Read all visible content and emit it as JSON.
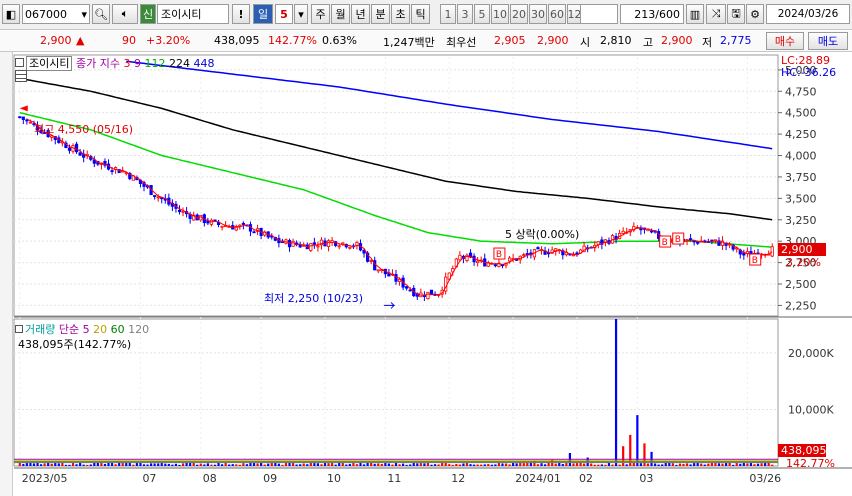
{
  "toolbar": {
    "code": "067000",
    "new_badge": "신",
    "stock_name": "조이시티",
    "alert_btn": "!",
    "period_unit": "일",
    "period_num": "5",
    "periods": [
      "주",
      "월",
      "년",
      "분",
      "초",
      "틱"
    ],
    "intervals": [
      "1",
      "3",
      "5",
      "10",
      "20",
      "30",
      "60",
      "120"
    ],
    "count": "213",
    "count_total": "/600",
    "date": "2024/03/26"
  },
  "price_bar": {
    "price": "2,900",
    "arrow": "▲",
    "change": "90",
    "change_pct": "+3.20%",
    "volume": "438,095",
    "vol_ratio": "142.77%",
    "turnover": "0.63%",
    "amount": "1,247백만",
    "best_ask_label": "최우선",
    "best_ask": "2,905",
    "best_bid": "2,900",
    "open_label": "시",
    "open": "2,810",
    "high_label": "고",
    "high": "2,900",
    "low_label": "저",
    "low": "2,775",
    "buy_btn": "매수",
    "sell_btn": "매도"
  },
  "colors": {
    "up": "#ff0000",
    "down": "#0000ff",
    "ma3": "#ff0000",
    "ma9": "#a000a0",
    "ma112": "#00dd00",
    "ma224": "#000000",
    "ma448": "#0000ff"
  },
  "chart_data": [
    {
      "type": "candlestick",
      "legend": {
        "title": "조이시티",
        "label": "종가 지수",
        "periods": [
          "3",
          "9",
          "112",
          "224",
          "448"
        ]
      },
      "ylim": [
        2150,
        5150
      ],
      "yticks": [
        5000,
        4750,
        4500,
        4250,
        4000,
        3750,
        3500,
        3250,
        3000,
        2750,
        2500,
        2250
      ],
      "ytick_labels": [
        "5,000",
        "4,750",
        "4,500",
        "4,250",
        "4,000",
        "3,750",
        "3,500",
        "3,250",
        "3,000",
        "2,750",
        "2,500",
        "2,250"
      ],
      "corner_labels": {
        "lc": "LC:28.89",
        "hc": "HC:-36.26"
      },
      "current_price": "2,900",
      "current_change": "3.20%",
      "high_annotation": "최고 4,550 (05/16)",
      "low_annotation": "최저 2,250 (10/23)",
      "signal_annotation": "5 상락(0.00%)",
      "signal_labels": [
        "B",
        "B",
        "B",
        "B"
      ],
      "x_labels": [
        "2023/05",
        "07",
        "08",
        "09",
        "10",
        "11",
        "12",
        "2024/01",
        "02",
        "03",
        "03/26"
      ],
      "close_anchors": [
        [
          0,
          4450
        ],
        [
          10,
          4200
        ],
        [
          20,
          3950
        ],
        [
          30,
          3800
        ],
        [
          38,
          3550
        ],
        [
          45,
          3350
        ],
        [
          55,
          3200
        ],
        [
          65,
          3150
        ],
        [
          72,
          3000
        ],
        [
          80,
          2950
        ],
        [
          88,
          3000
        ],
        [
          95,
          2950
        ],
        [
          100,
          2700
        ],
        [
          106,
          2550
        ],
        [
          112,
          2380
        ],
        [
          118,
          2400
        ],
        [
          124,
          2820
        ],
        [
          130,
          2750
        ],
        [
          137,
          2760
        ],
        [
          144,
          2850
        ],
        [
          150,
          2900
        ],
        [
          156,
          2850
        ],
        [
          162,
          2950
        ],
        [
          168,
          3050
        ],
        [
          174,
          3150
        ],
        [
          180,
          3050
        ],
        [
          186,
          3000
        ],
        [
          192,
          3000
        ],
        [
          198,
          2980
        ],
        [
          204,
          2840
        ],
        [
          212,
          2900
        ]
      ],
      "ma224": [
        [
          0,
          4900
        ],
        [
          20,
          4750
        ],
        [
          40,
          4550
        ],
        [
          60,
          4300
        ],
        [
          80,
          4100
        ],
        [
          100,
          3900
        ],
        [
          120,
          3700
        ],
        [
          140,
          3580
        ],
        [
          160,
          3500
        ],
        [
          180,
          3400
        ],
        [
          200,
          3320
        ],
        [
          212,
          3250
        ]
      ],
      "ma448": [
        [
          30,
          5100
        ],
        [
          60,
          4950
        ],
        [
          90,
          4800
        ],
        [
          120,
          4600
        ],
        [
          150,
          4420
        ],
        [
          180,
          4280
        ],
        [
          212,
          4080
        ]
      ],
      "ma112": [
        [
          0,
          4500
        ],
        [
          20,
          4300
        ],
        [
          40,
          4000
        ],
        [
          60,
          3800
        ],
        [
          80,
          3600
        ],
        [
          100,
          3300
        ],
        [
          115,
          3100
        ],
        [
          130,
          3000
        ],
        [
          150,
          2970
        ],
        [
          170,
          3000
        ],
        [
          190,
          3000
        ],
        [
          212,
          2930
        ]
      ]
    },
    {
      "type": "bar",
      "legend": {
        "title": "거래량",
        "label": "단순",
        "periods": [
          "5",
          "20",
          "60",
          "120"
        ]
      },
      "volume_label": "438,095주(142.77%)",
      "ylim": [
        0,
        26000000
      ],
      "yticks": [
        20000000,
        10000000
      ],
      "ytick_labels": [
        "20,000K",
        "10,000K"
      ],
      "current_volume": "438,095",
      "current_ratio": "142.77%",
      "spikes": [
        [
          168,
          26000000
        ],
        [
          170,
          3500000
        ],
        [
          172,
          5500000
        ],
        [
          174,
          9000000
        ],
        [
          176,
          4000000
        ],
        [
          178,
          2500000
        ],
        [
          145,
          900000
        ],
        [
          150,
          1100000
        ],
        [
          155,
          2300000
        ],
        [
          160,
          1500000
        ],
        [
          115,
          700000
        ],
        [
          120,
          800000
        ]
      ]
    }
  ]
}
